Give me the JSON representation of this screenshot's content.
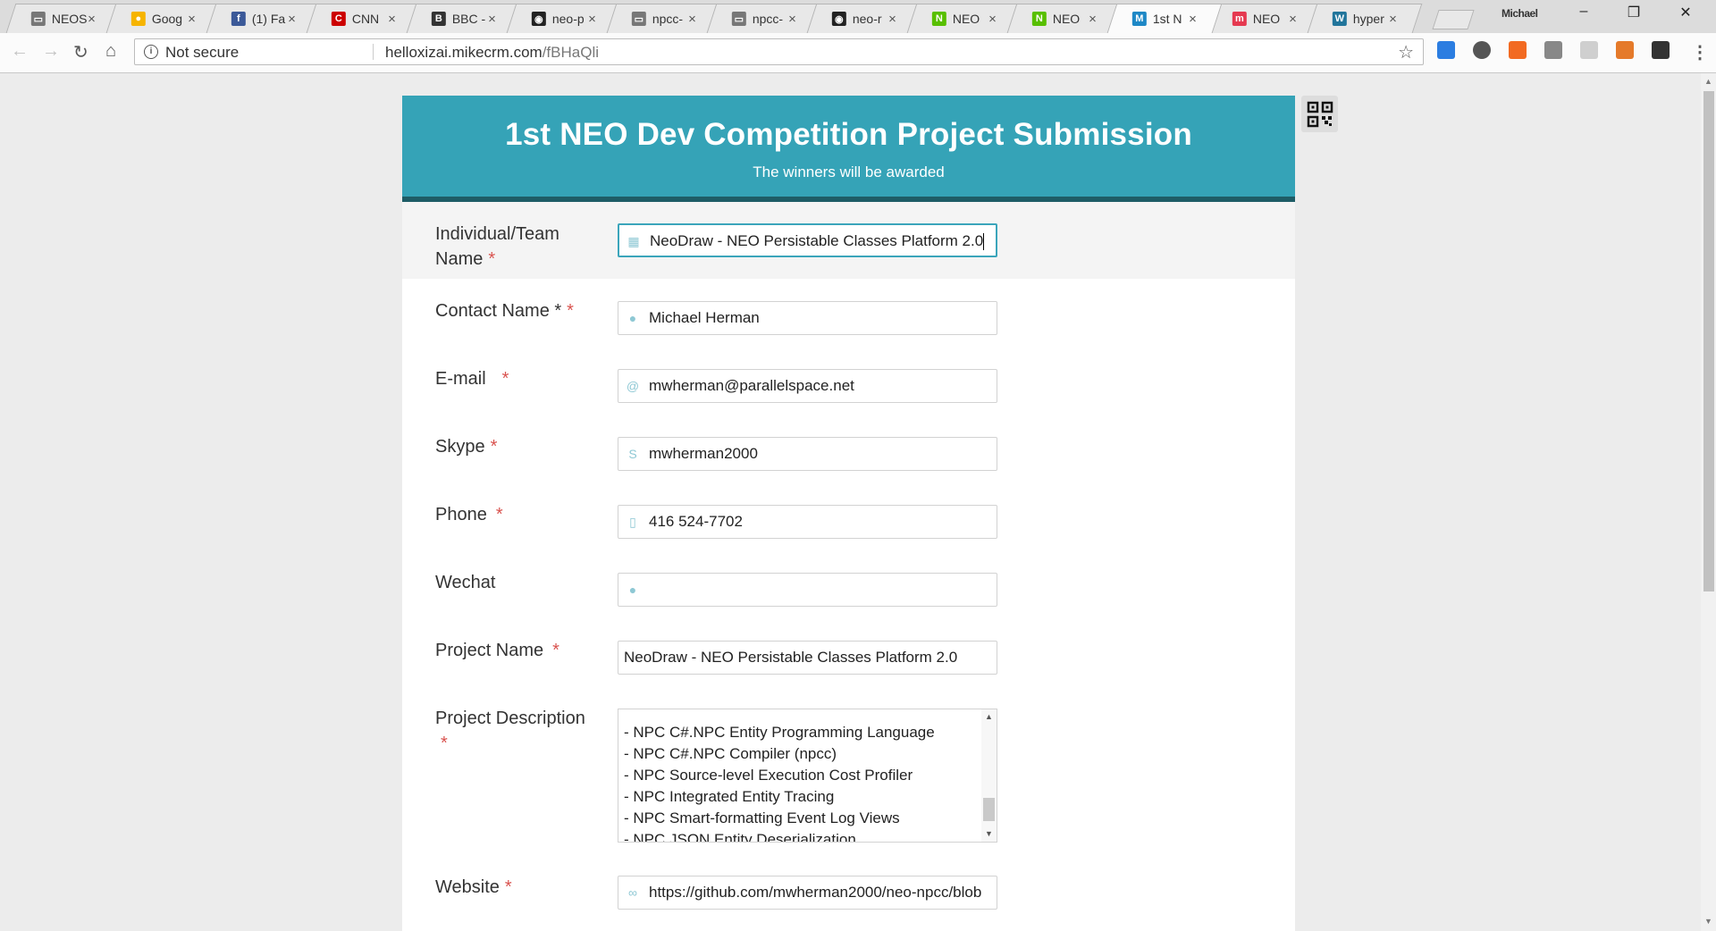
{
  "tabs": [
    {
      "title": "NEOS",
      "icon": "page-icon",
      "color": "#777777",
      "glyph": "▭"
    },
    {
      "title": "Goog",
      "icon": "google-keep-icon",
      "color": "#f6b400",
      "glyph": "●"
    },
    {
      "title": "(1) Fa",
      "icon": "facebook-icon",
      "color": "#3b5998",
      "glyph": "f"
    },
    {
      "title": "CNN",
      "icon": "cnn-icon",
      "color": "#cc0000",
      "glyph": "C"
    },
    {
      "title": "BBC -",
      "icon": "bbc-icon",
      "color": "#333333",
      "glyph": "B"
    },
    {
      "title": "neo-p",
      "icon": "github-icon",
      "color": "#222222",
      "glyph": "◉"
    },
    {
      "title": "npcc-",
      "icon": "page-icon",
      "color": "#777777",
      "glyph": "▭"
    },
    {
      "title": "npcc-",
      "icon": "page-icon",
      "color": "#777777",
      "glyph": "▭"
    },
    {
      "title": "neo-r",
      "icon": "github-icon",
      "color": "#222222",
      "glyph": "◉"
    },
    {
      "title": "NEO",
      "icon": "neo-icon",
      "color": "#58bf00",
      "glyph": "N"
    },
    {
      "title": "NEO",
      "icon": "neo-icon",
      "color": "#58bf00",
      "glyph": "N"
    },
    {
      "title": "1st N",
      "icon": "mikecrm-icon",
      "color": "#1e88c6",
      "glyph": "M",
      "active": true
    },
    {
      "title": "NEO",
      "icon": "mikecrm-red-icon",
      "color": "#e53950",
      "glyph": "m"
    },
    {
      "title": "hyper",
      "icon": "wordpress-icon",
      "color": "#21759b",
      "glyph": "W"
    }
  ],
  "profile_name": "Michael",
  "toolbar": {
    "security_label": "Not secure",
    "url_host": "helloxizai.mikecrm.com",
    "url_path": "/fBHaQli"
  },
  "form": {
    "title": "1st NEO Dev Competition Project Submission",
    "subtitle": "The winners will be awarded",
    "fields": {
      "team_name": {
        "label": "Individual/Team Name",
        "required": "*",
        "value": "NeoDraw - NEO Persistable Classes Platform 2.0",
        "icon": "building-icon"
      },
      "contact_name": {
        "label": "Contact Name *",
        "required": "*",
        "value": "Michael Herman",
        "icon": "person-icon"
      },
      "email": {
        "label": "E-mail",
        "required": "*",
        "value": "mwherman@parallelspace.net",
        "icon": "at-icon"
      },
      "skype": {
        "label": "Skype",
        "required": "*",
        "value": "mwherman2000",
        "icon": "skype-icon"
      },
      "phone": {
        "label": "Phone",
        "required": "*",
        "value": "416 524-7702",
        "icon": "phone-icon"
      },
      "wechat": {
        "label": "Wechat",
        "required": "",
        "value": "",
        "icon": "wechat-icon"
      },
      "project_name": {
        "label": "Project Name",
        "required": "*",
        "value": "NeoDraw - NEO Persistable Classes Platform 2.0"
      },
      "project_description": {
        "label": "Project Description",
        "required": "*",
        "lines": [
          "- NPC C#.NPC Entity Programming Language",
          "- NPC C#.NPC Compiler (npcc)",
          "- NPC Source-level Execution Cost Profiler",
          "- NPC Integrated Entity Tracing",
          "- NPC Smart-formatting Event Log Views",
          "- NPC JSON Entity Deserialization"
        ]
      },
      "website": {
        "label": "Website",
        "required": "*",
        "value": "https://github.com/mwherman2000/neo-npcc/blob",
        "icon": "link-icon"
      }
    }
  },
  "colors": {
    "header_bg": "#35a3b7",
    "header_border": "#1e5c66",
    "required": "#d9534f",
    "focus": "#3ba5bb"
  }
}
